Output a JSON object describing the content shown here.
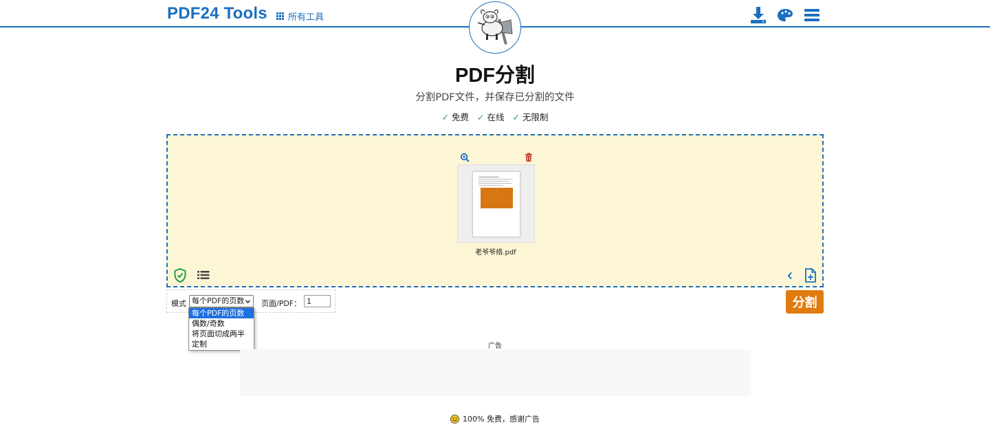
{
  "header": {
    "brand": "PDF24 Tools",
    "all_tools_label": "所有工具"
  },
  "page": {
    "title": "PDF分割",
    "subtitle": "分割PDF文件，并保存已分割的文件",
    "features": [
      "免费",
      "在线",
      "无限制"
    ],
    "check_mark": "✓"
  },
  "file": {
    "name": "老爷爷络.pdf"
  },
  "options": {
    "mode_label": "模式",
    "mode_selected": "每个PDF的页数",
    "mode_options": [
      "每个PDF的页数",
      "偶数/奇数",
      "将页面切成两半",
      "定制"
    ],
    "pages_label": "页面/PDF：",
    "pages_value": "1"
  },
  "actions": {
    "split_label": "分割"
  },
  "ad": {
    "label": "广告"
  },
  "footer": {
    "note": "100% 免费，感谢广告"
  },
  "colors": {
    "brand_blue": "#1a6fc0",
    "work_area_bg": "#fdf6d6",
    "split_orange": "#e07b10",
    "check_green": "#2aa04a",
    "delete_red": "#c0392b",
    "shield_green": "#1f9d3f"
  }
}
